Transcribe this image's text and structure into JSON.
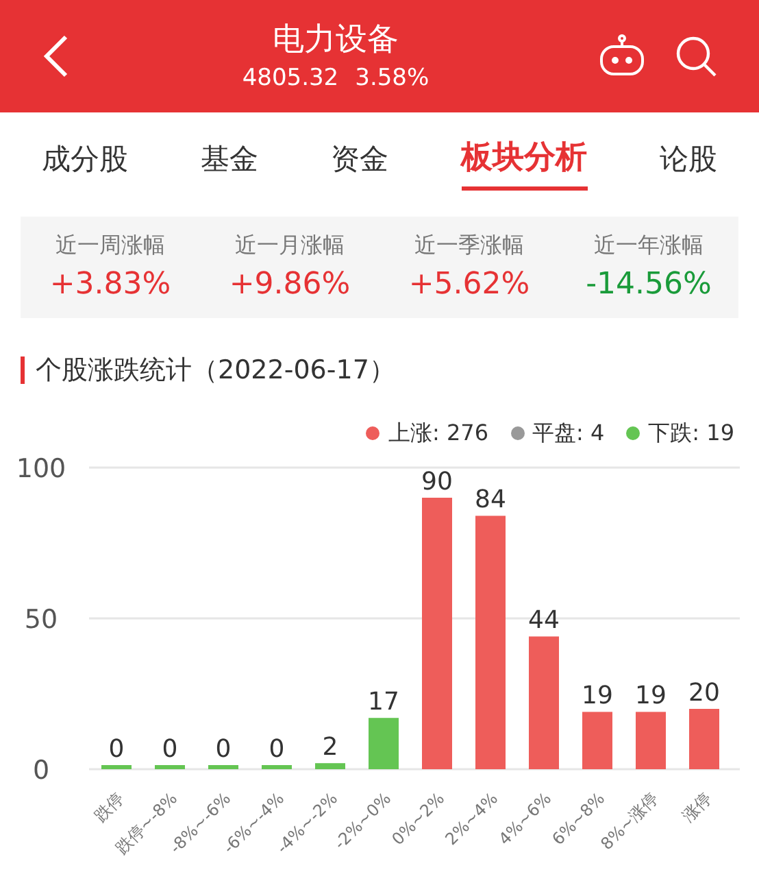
{
  "header": {
    "title": "电力设备",
    "price": "4805.32",
    "change": "3.58%"
  },
  "tabs": [
    {
      "label": "成分股",
      "selected": false
    },
    {
      "label": "基金",
      "selected": false
    },
    {
      "label": "资金",
      "selected": false
    },
    {
      "label": "板块分析",
      "selected": true
    },
    {
      "label": "论股",
      "selected": false
    }
  ],
  "stats": [
    {
      "label": "近一周涨幅",
      "value": "+3.83%",
      "color": "#e63234"
    },
    {
      "label": "近一月涨幅",
      "value": "+9.86%",
      "color": "#e63234"
    },
    {
      "label": "近一季涨幅",
      "value": "+5.62%",
      "color": "#e63234"
    },
    {
      "label": "近一年涨幅",
      "value": "-14.56%",
      "color": "#1a9b3a"
    }
  ],
  "section_title": "个股涨跌统计（2022-06-17）",
  "legend": [
    {
      "label": "上涨: 276",
      "color": "#ee5d5a"
    },
    {
      "label": "平盘: 4",
      "color": "#999999"
    },
    {
      "label": "下跌: 19",
      "color": "#64c553"
    }
  ],
  "chart_data": {
    "type": "bar",
    "categories": [
      "跌停",
      "跌停~-8%",
      "-8%~-6%",
      "-6%~-4%",
      "-4%~-2%",
      "-2%~0%",
      "0%~2%",
      "2%~4%",
      "4%~6%",
      "6%~8%",
      "8%~涨停",
      "涨停"
    ],
    "series": [
      {
        "color": "#64c553",
        "values": [
          0,
          0,
          0,
          0,
          2,
          17,
          null,
          null,
          null,
          null,
          null,
          null
        ]
      },
      {
        "color": "#ee5d5a",
        "values": [
          null,
          null,
          null,
          null,
          null,
          null,
          90,
          84,
          44,
          19,
          19,
          20
        ]
      }
    ],
    "ylim": [
      0,
      100
    ],
    "yticks": [
      0,
      50,
      100
    ],
    "data_labels": true
  }
}
